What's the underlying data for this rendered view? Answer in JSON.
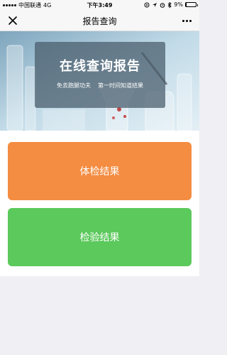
{
  "status_bar": {
    "carrier": "中国联通",
    "network": "4G",
    "time": "下午3:49",
    "battery_percent": "9%",
    "battery_level": 0.09
  },
  "nav": {
    "title": "报告查询"
  },
  "banner": {
    "title": "在线查询报告",
    "subtitle_left": "免去跑腿功夫",
    "subtitle_right": "第一时间知道结果"
  },
  "buttons": {
    "physical_exam": "体检结果",
    "lab_test": "检验结果"
  },
  "colors": {
    "exam_button": "#f48c42",
    "test_button": "#5bc95b",
    "page_background": "#efeff4"
  },
  "icons": [
    "signal-icon",
    "location-icon",
    "alarm-icon",
    "bluetooth-icon",
    "battery-icon",
    "close-icon",
    "more-icon"
  ]
}
